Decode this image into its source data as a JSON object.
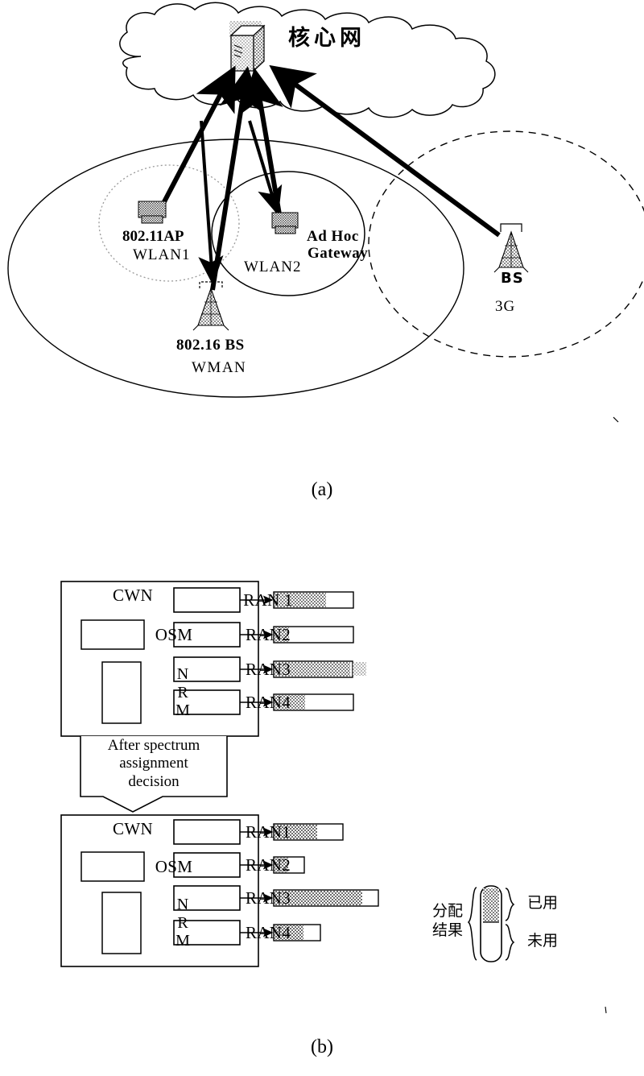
{
  "figure_a": {
    "caption": "(a)",
    "core_network_label": "核心网",
    "cloud": {
      "name": "core-network-cloud"
    },
    "server_icon": "server-icon",
    "nodes": [
      {
        "id": "ap",
        "icon": "wireless-ap-icon",
        "label": "802.11AP",
        "sublabel": "WLAN1"
      },
      {
        "id": "adhoc",
        "icon": "wireless-ap-icon",
        "label": "Ad Hoc",
        "sublabel": "Gateway"
      },
      {
        "id": "bs16",
        "icon": "base-station-tower-icon",
        "label": "802.16 BS",
        "sublabel": "WMAN"
      },
      {
        "id": "bs3g",
        "icon": "base-station-tower-icon",
        "label": "BS",
        "sublabel": "3G"
      }
    ],
    "regions": [
      {
        "id": "wman",
        "label": "WMAN",
        "style": "solid"
      },
      {
        "id": "wlan1",
        "label": "WLAN1",
        "style": "dotted"
      },
      {
        "id": "wlan2",
        "label": "WLAN2",
        "style": "solid"
      },
      {
        "id": "3g",
        "label": "3G",
        "style": "dashed"
      }
    ]
  },
  "figure_b": {
    "caption": "(b)",
    "transition_text": "After spectrum\nassignment\ndecision",
    "transition_lines": [
      "After spectrum",
      "assignment",
      "decision"
    ],
    "blocks": [
      {
        "id": "before",
        "title": "CWN",
        "modules": [
          {
            "id": "osm",
            "label": "OSM"
          },
          {
            "id": "nrm",
            "label": "NRM",
            "stacked": [
              "N",
              "R",
              "M"
            ]
          }
        ],
        "rans": [
          {
            "label": "RAN 1",
            "bar": {
              "total": 99,
              "used_pct": 65
            }
          },
          {
            "label": "RAN2",
            "bar": {
              "total": 99,
              "used_pct": 18
            }
          },
          {
            "label": "RAN3",
            "bar": {
              "total": 98,
              "used_pct": 96
            }
          },
          {
            "label": "RAN4",
            "bar": {
              "total": 99,
              "used_pct": 38
            }
          }
        ]
      },
      {
        "id": "after",
        "title": "CWN",
        "modules": [
          {
            "id": "osm",
            "label": "OSM"
          },
          {
            "id": "nrm",
            "label": "NRM",
            "stacked": [
              "N",
              "R",
              "M"
            ]
          }
        ],
        "rans": [
          {
            "label": "RAN1",
            "bar": {
              "total": 86,
              "used_pct": 62
            }
          },
          {
            "label": "RAN2",
            "bar": {
              "total": 38,
              "used_pct": 45
            }
          },
          {
            "label": "RAN3",
            "bar": {
              "total": 130,
              "used_pct": 84
            }
          },
          {
            "label": "RAN4",
            "bar": {
              "total": 58,
              "used_pct": 62
            }
          }
        ]
      }
    ],
    "legend": {
      "left_label_lines": [
        "分配",
        "结果"
      ],
      "used_label": "已用",
      "unused_label": "未用"
    }
  },
  "colors": {
    "ink": "#000000",
    "background": "#ffffff",
    "fill_hatch": "#8a8a8a",
    "fill_hatch_light": "#b5b5b5"
  }
}
